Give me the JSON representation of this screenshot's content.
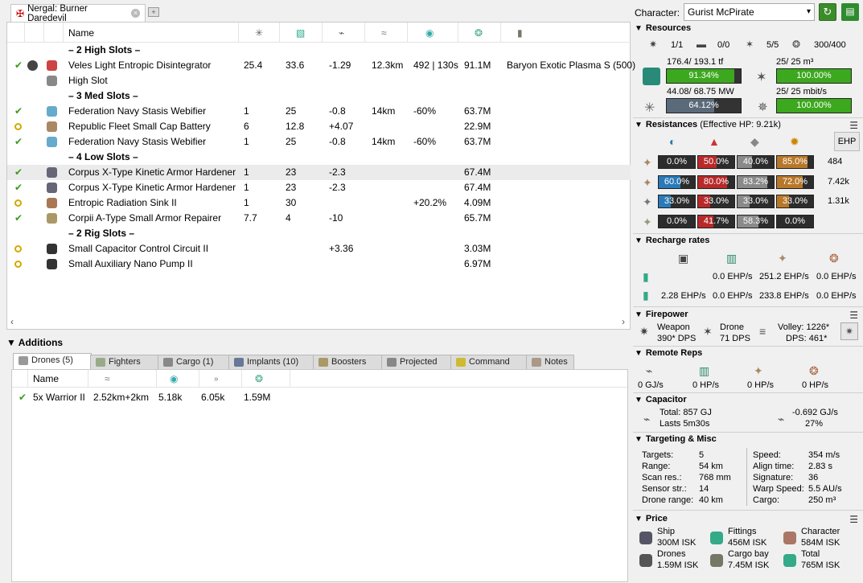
{
  "tab": {
    "title": "Nergal: Burner Daredevil"
  },
  "fit": {
    "header": {
      "name": "Name"
    },
    "rows": [
      {
        "kind": "sep",
        "name": "– 2 High Slots –"
      },
      {
        "kind": "mod",
        "state": "check",
        "name": "Veles Light Entropic Disintegrator",
        "c1": "25.4",
        "c2": "33.6",
        "c3": "-1.29",
        "c4": "12.3km",
        "c5": "492 | 130s",
        "c6": "91.1M",
        "c7": "Baryon Exotic Plasma S (500)",
        "ic": "#c44",
        "ic2": "#444"
      },
      {
        "kind": "mod",
        "state": "",
        "name": "High Slot",
        "c1": "",
        "c2": "",
        "c3": "",
        "c4": "",
        "c5": "",
        "c6": "",
        "c7": "",
        "ic": "#888"
      },
      {
        "kind": "sep",
        "name": "– 3 Med Slots –"
      },
      {
        "kind": "mod",
        "state": "check",
        "name": "Federation Navy Stasis Webifier",
        "c1": "1",
        "c2": "25",
        "c3": "-0.8",
        "c4": "14km",
        "c5": "-60%",
        "c6": "63.7M",
        "c7": "",
        "ic": "#6ac"
      },
      {
        "kind": "mod",
        "state": "ring",
        "name": "Republic Fleet Small Cap Battery",
        "c1": "6",
        "c2": "12.8",
        "c3": "+4.07",
        "c4": "",
        "c5": "",
        "c6": "22.9M",
        "c7": "",
        "ic": "#a86"
      },
      {
        "kind": "mod",
        "state": "check",
        "name": "Federation Navy Stasis Webifier",
        "c1": "1",
        "c2": "25",
        "c3": "-0.8",
        "c4": "14km",
        "c5": "-60%",
        "c6": "63.7M",
        "c7": "",
        "ic": "#6ac"
      },
      {
        "kind": "sep",
        "name": "– 4 Low Slots –"
      },
      {
        "kind": "mod",
        "state": "check",
        "name": "Corpus X-Type Kinetic Armor Hardener",
        "c1": "1",
        "c2": "23",
        "c3": "-2.3",
        "c4": "",
        "c5": "",
        "c6": "67.4M",
        "c7": "",
        "ic": "#667",
        "sel": true
      },
      {
        "kind": "mod",
        "state": "check",
        "name": "Corpus X-Type Kinetic Armor Hardener",
        "c1": "1",
        "c2": "23",
        "c3": "-2.3",
        "c4": "",
        "c5": "",
        "c6": "67.4M",
        "c7": "",
        "ic": "#667"
      },
      {
        "kind": "mod",
        "state": "ring",
        "name": "Entropic Radiation Sink II",
        "c1": "1",
        "c2": "30",
        "c3": "",
        "c4": "",
        "c5": "+20.2%",
        "c6": "4.09M",
        "c7": "",
        "ic": "#a75"
      },
      {
        "kind": "mod",
        "state": "check",
        "name": "Corpii A-Type Small Armor Repairer",
        "c1": "7.7",
        "c2": "4",
        "c3": "-10",
        "c4": "",
        "c5": "",
        "c6": "65.7M",
        "c7": "",
        "ic": "#a96"
      },
      {
        "kind": "sep",
        "name": "– 2 Rig Slots –"
      },
      {
        "kind": "mod",
        "state": "ring",
        "name": "Small Capacitor Control Circuit II",
        "c1": "",
        "c2": "",
        "c3": "+3.36",
        "c4": "",
        "c5": "",
        "c6": "3.03M",
        "c7": "",
        "ic": "#333"
      },
      {
        "kind": "mod",
        "state": "ring",
        "name": "Small Auxiliary Nano Pump II",
        "c1": "",
        "c2": "",
        "c3": "",
        "c4": "",
        "c5": "",
        "c6": "6.97M",
        "c7": "",
        "ic": "#333"
      }
    ]
  },
  "additions": {
    "title": "Additions",
    "tabs": [
      "Drones (5)",
      "Fighters",
      "Cargo (1)",
      "Implants (10)",
      "Boosters",
      "Projected",
      "Command",
      "Notes"
    ],
    "drone_header": {
      "name": "Name"
    },
    "drones": [
      {
        "name": "5x Warrior II",
        "range": "2.52km+2km",
        "speed": "5.18k",
        "c3": "6.05k",
        "price": "1.59M"
      }
    ]
  },
  "right": {
    "character_label": "Character:",
    "character": "Gurist McPirate",
    "resources": {
      "title": "Resources",
      "turrets": "1/1",
      "launchers": "0/0",
      "drones_active": "5/5",
      "calibration": "300/400",
      "cpu_text": "176.4/ 193.1 tf",
      "cpu_pct": "91.34%",
      "cpu_val": 0.9134,
      "drone_bay_text": "25/ 25 m³",
      "drone_bay_pct": "100.00%",
      "drone_bay_val": 1.0,
      "pg_text": "44.08/ 68.75 MW",
      "pg_pct": "64.12%",
      "pg_val": 0.6412,
      "bandwidth_text": "25/ 25 mbit/s",
      "bandwidth_pct": "100.00%",
      "bandwidth_val": 1.0
    },
    "resistances": {
      "title": "Resistances",
      "ehp": "(Effective HP: 9.21k)",
      "ehp_button": "EHP",
      "rows": [
        {
          "vals": [
            "0.0%",
            "50.0%",
            "40.0%",
            "85.0%"
          ],
          "nums": [
            0.0,
            0.5,
            0.4,
            0.85
          ],
          "hp": "484"
        },
        {
          "vals": [
            "60.0%",
            "80.0%",
            "83.2%",
            "72.0%"
          ],
          "nums": [
            0.6,
            0.8,
            0.832,
            0.72
          ],
          "hp": "7.42k"
        },
        {
          "vals": [
            "33.0%",
            "33.0%",
            "33.0%",
            "33.0%"
          ],
          "nums": [
            0.33,
            0.33,
            0.33,
            0.33
          ],
          "hp": "1.31k"
        },
        {
          "vals": [
            "0.0%",
            "41.7%",
            "58.3%",
            "0.0%"
          ],
          "nums": [
            0.0,
            0.417,
            0.583,
            0.0
          ],
          "hp": ""
        }
      ]
    },
    "recharge": {
      "title": "Recharge rates",
      "row1": [
        "0.0 EHP/s",
        "251.2 EHP/s",
        "0.0 EHP/s"
      ],
      "row2": [
        "2.28 EHP/s",
        "0.0 EHP/s",
        "233.8 EHP/s",
        "0.0 EHP/s"
      ]
    },
    "firepower": {
      "title": "Firepower",
      "weapon_label": "Weapon",
      "weapon_dps": "390* DPS",
      "drone_label": "Drone",
      "drone_dps": "71 DPS",
      "volley": "Volley: 1226*",
      "dps": "DPS: 461*"
    },
    "remote_reps": {
      "title": "Remote Reps",
      "vals": [
        "0 GJ/s",
        "0 HP/s",
        "0 HP/s",
        "0 HP/s"
      ]
    },
    "capacitor": {
      "title": "Capacitor",
      "total": "Total: 857 GJ",
      "lasts": "Lasts 5m30s",
      "rate": "-0.692 GJ/s",
      "pct": "27%"
    },
    "targeting": {
      "title": "Targeting & Misc",
      "left": [
        [
          "Targets:",
          "5"
        ],
        [
          "Range:",
          "54 km"
        ],
        [
          "Scan res.:",
          "768 mm"
        ],
        [
          "Sensor str.:",
          "14"
        ],
        [
          "Drone range:",
          "40 km"
        ]
      ],
      "right": [
        [
          "Speed:",
          "354 m/s"
        ],
        [
          "Align time:",
          "2.83 s"
        ],
        [
          "Signature:",
          "36"
        ],
        [
          "Warp Speed:",
          "5.5 AU/s"
        ],
        [
          "Cargo:",
          "250 m³"
        ]
      ]
    },
    "price": {
      "title": "Price",
      "items": [
        {
          "label": "Ship",
          "val": "300M ISK"
        },
        {
          "label": "Fittings",
          "val": "456M ISK"
        },
        {
          "label": "Character",
          "val": "584M ISK"
        },
        {
          "label": "Drones",
          "val": "1.59M ISK"
        },
        {
          "label": "Cargo bay",
          "val": "7.45M ISK"
        },
        {
          "label": "Total",
          "val": "765M ISK"
        }
      ]
    }
  }
}
